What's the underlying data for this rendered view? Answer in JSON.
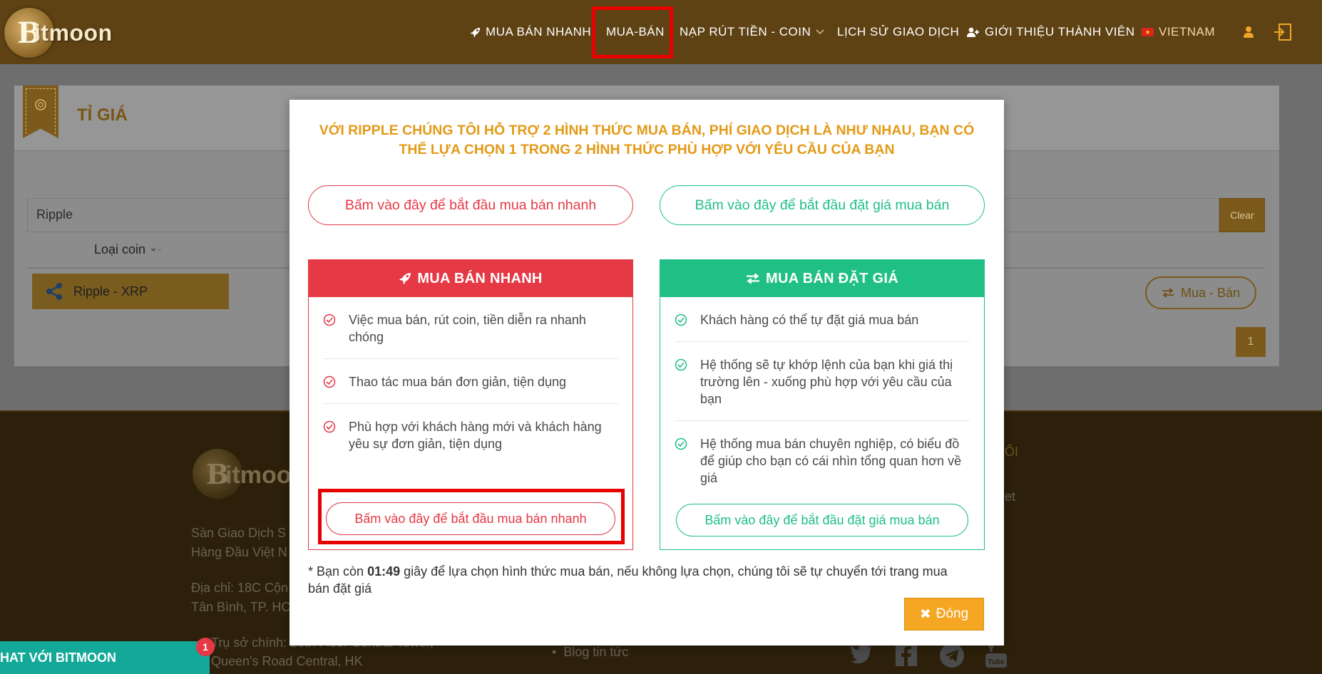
{
  "brand": {
    "logo_letter": "B",
    "logo_text": "itmoon"
  },
  "nav": {
    "quick_trade": "MUA BÁN NHANH",
    "trade": "MUA-BÁN",
    "deposit_withdraw": "NẠP RÚT TIỀN - COIN",
    "history": "LỊCH SỬ GIAO DỊCH",
    "referral": "GIỚI THIỆU THÀNH VIÊN",
    "language": "VIETNAM"
  },
  "panel": {
    "title": "TỈ GIÁ",
    "search_value": "Ripple",
    "clear_label": "Clear",
    "column_coin_type": "Loại coin",
    "coin_row_label": "Ripple - XRP",
    "trade_button": "Mua - Bán",
    "page_number": "1"
  },
  "footer": {
    "logo_text": "itmoo",
    "line1": "Sàn Giao Dịch S",
    "line2": "Hàng Đầu Việt N",
    "line3": "Địa chỉ: 18C Cộn",
    "line4": "Tân Bình, TP. HC",
    "line5": "Trụ sở chính: 20th Floor Central Tower,",
    "line6": "Queen's Road Central, HK",
    "link_blog": "Blog tin tức",
    "heading_right_fragment": "ÔI",
    "link_right_fragment": "et",
    "social_icons": [
      "twitter-icon",
      "facebook-icon",
      "telegram-icon",
      "youtube-icon"
    ]
  },
  "chat": {
    "label": "HAT VỚI BITMOON",
    "badge_count": "1"
  },
  "modal": {
    "heading_line1": "VỚI RIPPLE CHÚNG TÔI HỖ TRỢ 2 HÌNH THỨC MUA BÁN, PHÍ GIAO DỊCH LÀ NHƯ NHAU, BẠN CÓ",
    "heading_line2": "THỂ LỰA CHỌN 1 TRONG 2 HÌNH THỨC PHÙ HỢP VỚI YÊU CẦU CỦA BẠN",
    "top_quick_button": "Bấm vào đây để bắt đầu mua bán nhanh",
    "top_limit_button": "Bấm vào đây để bắt đầu đặt giá mua bán",
    "quick_card": {
      "title": "MUA BÁN NHANH",
      "features": [
        {
          "line1": "Việc mua bán, rút coin, tiền diễn ra nhanh",
          "line2": "chóng"
        },
        {
          "line1": "Thao tác mua bán đơn giản, tiện dụng",
          "line2": ""
        },
        {
          "line1": "Phù hợp với khách hàng mới và khách hàng",
          "line2": "yêu sự đơn giản, tiện dụng"
        }
      ],
      "button": "Bấm vào đây để bắt đầu mua bán nhanh"
    },
    "limit_card": {
      "title": "MUA BÁN ĐẶT GIÁ",
      "features": [
        {
          "line1": "Khách hàng có thể tự đặt giá mua bán",
          "line2": "",
          "line3": ""
        },
        {
          "line1": "Hệ thống sẽ tự khớp lệnh của bạn khi giá thị",
          "line2": "trường lên - xuống phù hợp với yêu cầu của",
          "line3": "bạn"
        },
        {
          "line1": "Hệ thống mua bán chuyên nghiệp, có biểu đồ",
          "line2": "để giúp cho bạn có cái nhìn tổng quan hơn về",
          "line3": "giá"
        }
      ],
      "button": "Bấm vào đây để bắt đầu đặt giá mua bán"
    },
    "note_prefix": "* Bạn còn",
    "note_time": "01:49",
    "note_suffix": "giây để lựa chọn hình thức mua bán, nếu không lựa chọn, chúng tôi sẽ tự chuyển tới trang mua",
    "note_line2": "bán đặt giá",
    "close_label": "Đóng"
  },
  "colors": {
    "nav_bg": "#5e4214",
    "accent_orange": "#e39a17",
    "quick_red": "#e53946",
    "limit_green": "#1fbf85",
    "highlight_red": "#e60000",
    "close_button": "#f5a623",
    "chat_teal": "#13a897"
  }
}
